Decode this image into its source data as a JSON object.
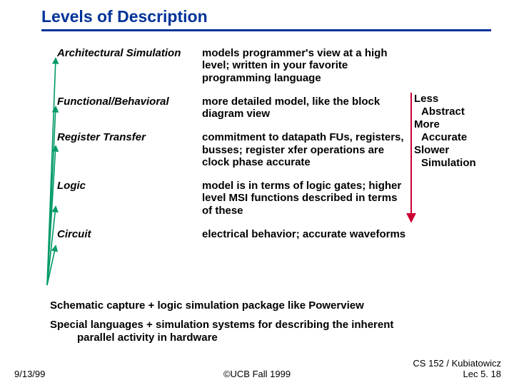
{
  "title": "Levels of Description",
  "levels": [
    {
      "name": "Architectural Simulation",
      "desc": "models programmer's view at a high level; written in your favorite programming language"
    },
    {
      "name": "Functional/Behavioral",
      "desc": "more detailed model, like the block diagram view"
    },
    {
      "name": "Register Transfer",
      "desc": "commitment to datapath FUs, registers, busses; register xfer operations are clock phase accurate"
    },
    {
      "name": "Logic",
      "desc": "model is in terms of logic gates; higher level MSI functions described in terms of these"
    },
    {
      "name": "Circuit",
      "desc": "electrical behavior; accurate waveforms"
    }
  ],
  "sidebar": {
    "l1": "Less",
    "l2": "Abstract",
    "l3": "More",
    "l4": "Accurate",
    "l5": "Slower",
    "l6": "Simulation"
  },
  "notes": {
    "n1": "Schematic capture + logic simulation package like Powerview",
    "n2a": "Special languages + simulation systems for describing the inherent",
    "n2b": "parallel activity in hardware"
  },
  "footer": {
    "date": "9/13/99",
    "center": "©UCB Fall 1999",
    "right1": "CS 152 / Kubiatowicz",
    "right2": "Lec 5. 18"
  }
}
